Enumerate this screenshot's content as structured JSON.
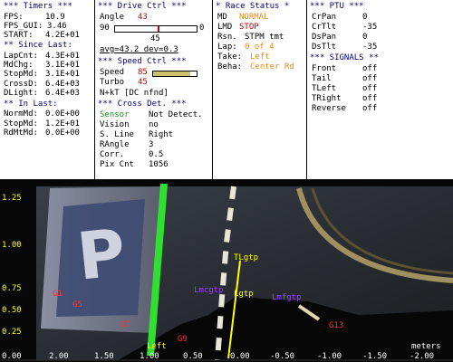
{
  "timers": {
    "header": "*** Timers ***",
    "fps_label": "FPS:",
    "fps": "10.9",
    "fps_gui_label": "FPS_GUI:",
    "fps_gui": "3.46",
    "start_label": "START:",
    "start": "4.2E+01",
    "since_header": "** Since Last:",
    "lapcnt_label": "LapCnt:",
    "lapcnt": "4.3E+01",
    "mdchg_label": "MdChg:",
    "mdchg": "3.1E+01",
    "stopmd_label": "StopMd:",
    "stopmd": "3.1E+01",
    "crossd_label": "CrossD:",
    "crossd": "6.4E+03",
    "dlight_label": "DLight:",
    "dlight": "6.4E+03",
    "inlast_header": "** In Last:",
    "normmd_label": "NormMd:",
    "normmd": "0.0E+00",
    "stopmd2_label": "StopMd:",
    "stopmd2": "1.2E+01",
    "rdmtmd_label": "RdMtMd:",
    "rdmtmd": "0.0E+00"
  },
  "drive": {
    "header": "*** Drive Ctrl ***",
    "angle_label": "Angle",
    "angle": "43",
    "range_min": "90",
    "range_max": "0",
    "center": "45",
    "avg": "avg=43.2 dev=0.3",
    "angle_fraction": 0.52,
    "speed_header": "*** Speed Ctrl ***",
    "speed_label": "Speed",
    "speed": "85",
    "speed_fraction": 0.85,
    "turbo_label": "Turbo",
    "turbo": "45",
    "turbo_fraction": 0.45,
    "nhkt": "N+kT [DC nfnd]"
  },
  "race": {
    "header": "* Race Status *",
    "md_label": "MD",
    "md": "NORMAL",
    "lmd_label": "LMD",
    "lmd": "STOP",
    "rsn_label": "Rsn.",
    "rsn": "STPM tmt",
    "lap_label": "Lap:",
    "lap": "0 of 4",
    "take_label": "Take:",
    "take": "Left",
    "beha_label": "Beha:",
    "beha": "Center Rd"
  },
  "crossdet": {
    "header": "*** Cross Det. ***",
    "sensor_label": "Sensor",
    "sensor": "Not Detect.",
    "vision_label": "Vision",
    "vision": "no",
    "sline_label": "S. Line",
    "sline": "Right",
    "rangle_label": "RAngle",
    "rangle": "3",
    "corr_label": "Corr.",
    "corr": "0.5",
    "pixcnt_label": "Pix Cnt",
    "pixcnt": "1056"
  },
  "ptu": {
    "header": "*** PTU ***",
    "crpan_label": "CrPan",
    "crpan": "0",
    "crtlt_label": "CrTlt",
    "crtlt": "-35",
    "dspan_label": "DsPan",
    "dspan": "0",
    "dstlt_label": "DsTlt",
    "dstlt": "-35",
    "signals_header": "*** SIGNALS **",
    "front_label": "Front",
    "front": "off",
    "tail_label": "Tail",
    "tail": "off",
    "tleft_label": "TLeft",
    "tleft": "off",
    "tright_label": "TRight",
    "tright": "off",
    "reverse_label": "Reverse",
    "reverse": "off"
  },
  "camera": {
    "y_ticks": [
      "1.25",
      "1.00",
      "0.75",
      "0.50",
      "0.25",
      "0.00"
    ],
    "x_ticks": [
      "2.00",
      "1.50",
      "1.00",
      "0.50",
      "0.00",
      "-0.50",
      "-1.00",
      "-1.50",
      "-2.00"
    ],
    "units": "meters",
    "markers": {
      "g1": "G1",
      "g3": "G3",
      "g7": "G7",
      "g9": "G9",
      "g13": "G13",
      "g5": "G5",
      "left": "Left",
      "tlgtp": "TLgtp",
      "lgtp": "Lgtp",
      "lmcgtp": "Lmcgtp",
      "lmfgtp": "Lmfgtp"
    }
  },
  "colors": {
    "header": "#000080",
    "highlight": "#cc0000",
    "status": "#e08a20",
    "sensor": "#1a8a1a",
    "axis_y": "#ffff00"
  }
}
